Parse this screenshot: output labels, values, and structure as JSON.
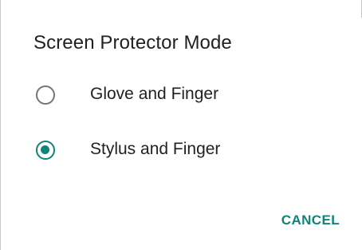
{
  "dialog": {
    "title": "Screen Protector Mode",
    "options": [
      {
        "label": "Glove and Finger",
        "selected": false
      },
      {
        "label": "Stylus and Finger",
        "selected": true
      }
    ],
    "cancel_label": "CANCEL"
  },
  "colors": {
    "accent": "#0f8478",
    "text": "#212121",
    "radio_unchecked": "#757575",
    "background": "#ffffff"
  }
}
